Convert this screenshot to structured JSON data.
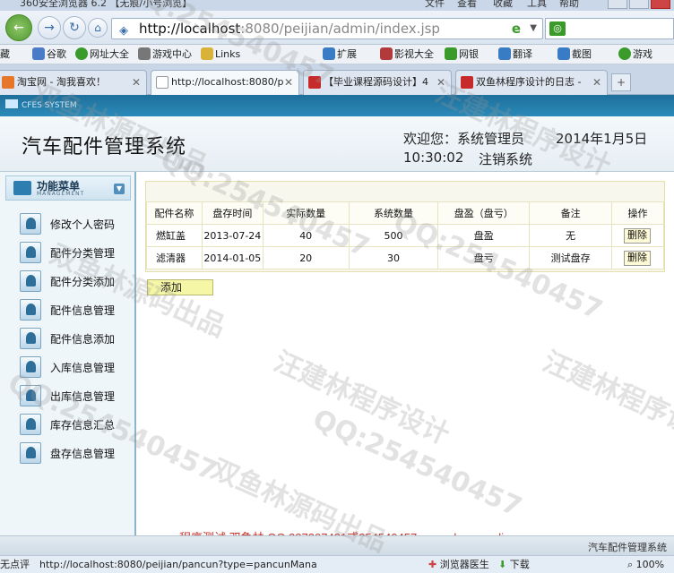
{
  "browser": {
    "window_title": "360安全浏览器 6.2 【无痕/小号浏览】",
    "menu": [
      "文件",
      "查看",
      "收藏",
      "工具",
      "帮助"
    ],
    "address_host": "http://localhost",
    "address_rest": ":8080/peijian/admin/index.jsp",
    "favorites": [
      {
        "label": "藏",
        "color": "#6c8fb5"
      },
      {
        "label": "谷歌",
        "color": "#4a7bc6"
      },
      {
        "label": "网址大全",
        "color": "#3a9a2a"
      },
      {
        "label": "游戏中心",
        "color": "#777"
      },
      {
        "label": "Links",
        "color": "#d9b23a"
      },
      {
        "label": "扩展",
        "color": "#3a7bc6"
      },
      {
        "label": "影视大全",
        "color": "#b23a3a"
      },
      {
        "label": "网银",
        "color": "#3a9a2a"
      },
      {
        "label": "翻译",
        "color": "#3a7bc6"
      },
      {
        "label": "截图",
        "color": "#3a7bc6"
      },
      {
        "label": "游戏",
        "color": "#3a9a2a"
      }
    ],
    "tabs": [
      {
        "label": "淘宝网 - 淘我喜欢！",
        "icon_color": "#e6762a"
      },
      {
        "label": "http://localhost:8080/p",
        "icon_color": "#bbb"
      },
      {
        "label": "【毕业课程源码设计】4",
        "icon_color": "#c62a2a"
      },
      {
        "label": "双鱼林程序设计的日志 -",
        "icon_color": "#c62a2a"
      }
    ],
    "status": {
      "left": "无点评",
      "url": "http://localhost:8080/peijian/pancun?type=pancunMana",
      "doctor": "浏览器医生",
      "download": "下载",
      "zoom": "100%"
    }
  },
  "app": {
    "logo_text": "CFES SYSTEM",
    "title": "汽车配件管理系统",
    "welcome": "欢迎您：系统管理员",
    "date": "2014年1月5日",
    "time": "10:30:02",
    "logout": "注销系统",
    "sidebar": {
      "header": "功能菜单",
      "header_sub": "MANAGEMENT",
      "items": [
        "修改个人密码",
        "配件分类管理",
        "配件分类添加",
        "配件信息管理",
        "配件信息添加",
        "入库信息管理",
        "出库信息管理",
        "库存信息汇总",
        "盘存信息管理"
      ]
    },
    "table": {
      "headers": [
        "配件名称",
        "盘存时间",
        "实际数量",
        "系统数量",
        "盘盈（盘亏）",
        "备注",
        "操作"
      ],
      "rows": [
        [
          "燃缸盖",
          "2013-07-24",
          "40",
          "500",
          "盘盈",
          "无"
        ],
        [
          "滤清器",
          "2014-01-05",
          "20",
          "30",
          "盘亏",
          "测试盘存"
        ]
      ],
      "delete_label": "删除"
    },
    "add_label": "添加",
    "promo": "程序测试:双鱼林 QQ:287307421或254540457 www.shuangyulin.com",
    "footer": "汽车配件管理系统"
  },
  "watermark": {
    "qq": "QQ:254540457",
    "author": "汪建林程序设计",
    "source": "双鱼林源码出品"
  }
}
